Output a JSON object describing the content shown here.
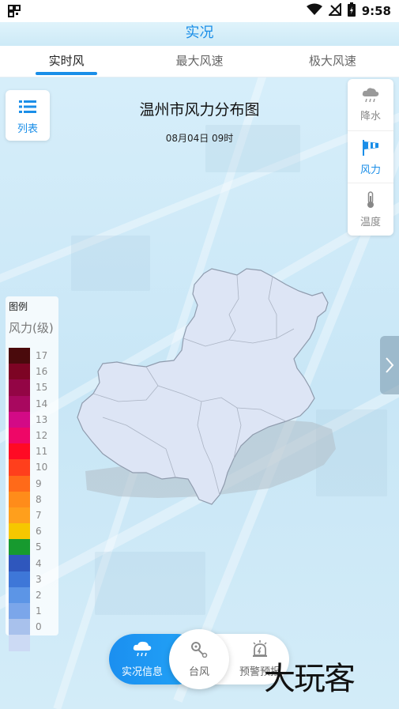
{
  "status_bar": {
    "time": "9:58"
  },
  "header": {
    "title": "实况"
  },
  "tabs": [
    {
      "label": "实时风",
      "active": true
    },
    {
      "label": "最大风速",
      "active": false
    },
    {
      "label": "极大风速",
      "active": false
    }
  ],
  "map": {
    "title": "温州市风力分布图",
    "time": "08月04日 09时"
  },
  "list_button": {
    "label": "列表"
  },
  "side_panel": [
    {
      "label": "降水",
      "icon": "rain-cloud-icon",
      "active": false
    },
    {
      "label": "风力",
      "icon": "wind-flag-icon",
      "active": true
    },
    {
      "label": "温度",
      "icon": "thermometer-icon",
      "active": false
    }
  ],
  "legend": {
    "title": "图例",
    "unit": "风力(级)",
    "levels": [
      {
        "label": "17",
        "color": "#4a0a0c"
      },
      {
        "label": "16",
        "color": "#7d0424"
      },
      {
        "label": "15",
        "color": "#930545"
      },
      {
        "label": "14",
        "color": "#a8085f"
      },
      {
        "label": "13",
        "color": "#d30a86"
      },
      {
        "label": "12",
        "color": "#ee0767"
      },
      {
        "label": "11",
        "color": "#ff0a24"
      },
      {
        "label": "10",
        "color": "#ff3f1c"
      },
      {
        "label": "9",
        "color": "#ff6a19"
      },
      {
        "label": "8",
        "color": "#ff8c1a"
      },
      {
        "label": "7",
        "color": "#ff9f1c"
      },
      {
        "label": "6",
        "color": "#f6c700"
      },
      {
        "label": "5",
        "color": "#179a2f"
      },
      {
        "label": "4",
        "color": "#2f57bd"
      },
      {
        "label": "3",
        "color": "#3e77d8"
      },
      {
        "label": "2",
        "color": "#5c95e6"
      },
      {
        "label": "1",
        "color": "#7ba6ea"
      },
      {
        "label": "0",
        "color": "#a8c1ec"
      },
      {
        "label": "",
        "color": "#ccdaf4"
      }
    ]
  },
  "bottom_nav": [
    {
      "label": "实况信息",
      "icon": "cloud-rain-icon",
      "active": true
    },
    {
      "label": "台风",
      "icon": "typhoon-icon",
      "active": false
    },
    {
      "label": "预警预报",
      "icon": "alarm-light-icon",
      "active": false
    }
  ],
  "watermark": "大玩客",
  "colors": {
    "accent": "#1a8ee8",
    "region_fill": "#dde5f5",
    "region_border": "#9aa4b6"
  }
}
